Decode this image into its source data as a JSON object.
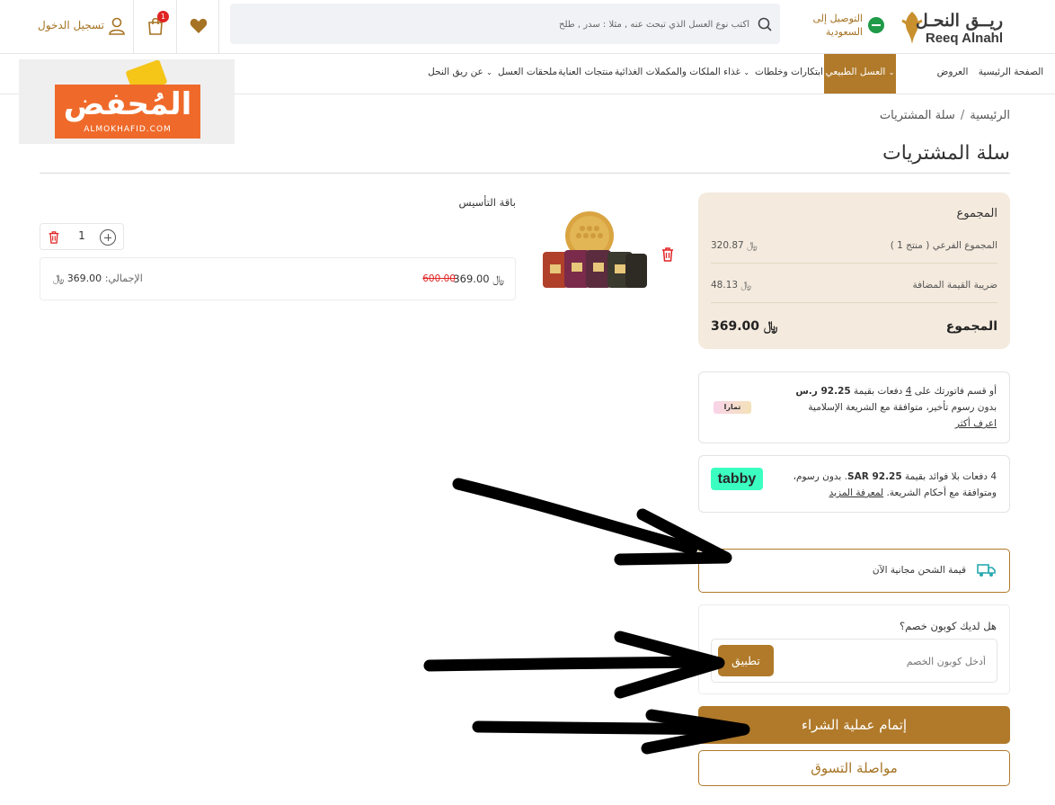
{
  "header": {
    "logo_ar": "ريــق النحـل",
    "logo_en": "Reeq Alnahl",
    "delivery_line1": "التوصيل إلى",
    "delivery_line2": "السعودية",
    "search_placeholder": "أكتب نوع العسل الذي تبحث عنه , مثلا : سدر , طلح",
    "cart_count": "1",
    "login_label": "تسجيل الدخول"
  },
  "nav": {
    "items": [
      "الصفحة الرئيسية",
      "العروض",
      "العسل الطبيعي",
      "ابتكارات وخلطات",
      "غذاء الملكات والمكملات الغذائية",
      "منتجات العناية",
      "ملحقات العسل",
      "عن ريق النحل"
    ],
    "active_index": 2
  },
  "promo": {
    "word": "المُحفض",
    "sub": "ALMOKHAFID.COM"
  },
  "breadcrumb": {
    "home": "الرئيسية",
    "separator": "/",
    "current": "سلة المشتريات"
  },
  "page_title": "سلة المشتريات",
  "cart_item": {
    "name": "باقة التأسيس",
    "quantity": "1",
    "price": "369.00",
    "old_price": "600.00",
    "total_label": "الإجمالي:",
    "total_value": "369.00"
  },
  "summary": {
    "heading": "المجموع",
    "subtotal_label": "المجموع الفرعي ( منتج 1 )",
    "subtotal_value": "320.87",
    "vat_label": "ضريبة القيمة المضافة",
    "vat_value": "48.13",
    "total_label": "المجموع",
    "total_value": "369.00"
  },
  "tamara": {
    "line1_pre": "أو قسم فاتورتك على ",
    "line1_count": "4",
    "line1_mid": " دفعات بقيمة ",
    "line1_amount": "92.25 ر.س",
    "line2": "بدون رسوم تأخير، متوافقة مع الشريعة الإسلامية",
    "learn_more": "اعرف أكثر",
    "logo_text": "تمارا"
  },
  "tabby": {
    "line1_pre": "4 دفعات بلا فوائد بقيمة ",
    "line1_amount": "SAR 92.25",
    "line1_post": ". بدون رسوم،",
    "line2_pre": "ومتوافقة مع أحكام الشريعة. ",
    "learn_more": "لمعرفة المزيد",
    "logo_text": "tabby"
  },
  "shipping": {
    "text": "قيمة الشحن مجانية الآن"
  },
  "coupon": {
    "question": "هل لديك كوبون خصم؟",
    "placeholder": "أدخل كوبون الخصم",
    "apply_label": "تطبيق"
  },
  "actions": {
    "checkout_label": "إتمام عملية الشراء",
    "continue_label": "مواصلة التسوق"
  },
  "colors": {
    "brand": "#b07a2a",
    "summary_bg": "#f4eadd",
    "tabby_green": "#3bffc1",
    "badge_red": "#e02424"
  }
}
